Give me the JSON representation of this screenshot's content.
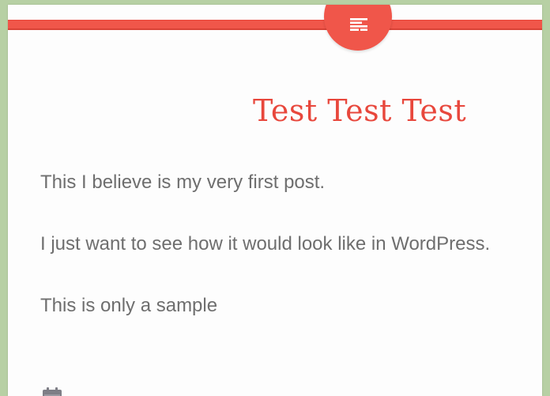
{
  "post": {
    "title": "Test Test Test",
    "paragraphs": [
      "This I believe is my very first post.",
      "I just want to see how it would look like in WordPress.",
      "This is only a sample"
    ]
  },
  "header": {
    "menu_icon": "menu-lines-icon"
  },
  "meta": {
    "icon": "calendar-icon"
  },
  "colors": {
    "accent": "#f0564a",
    "title": "#e8473c",
    "body_text": "#6e6e6e",
    "background": "#b7d0a4"
  }
}
